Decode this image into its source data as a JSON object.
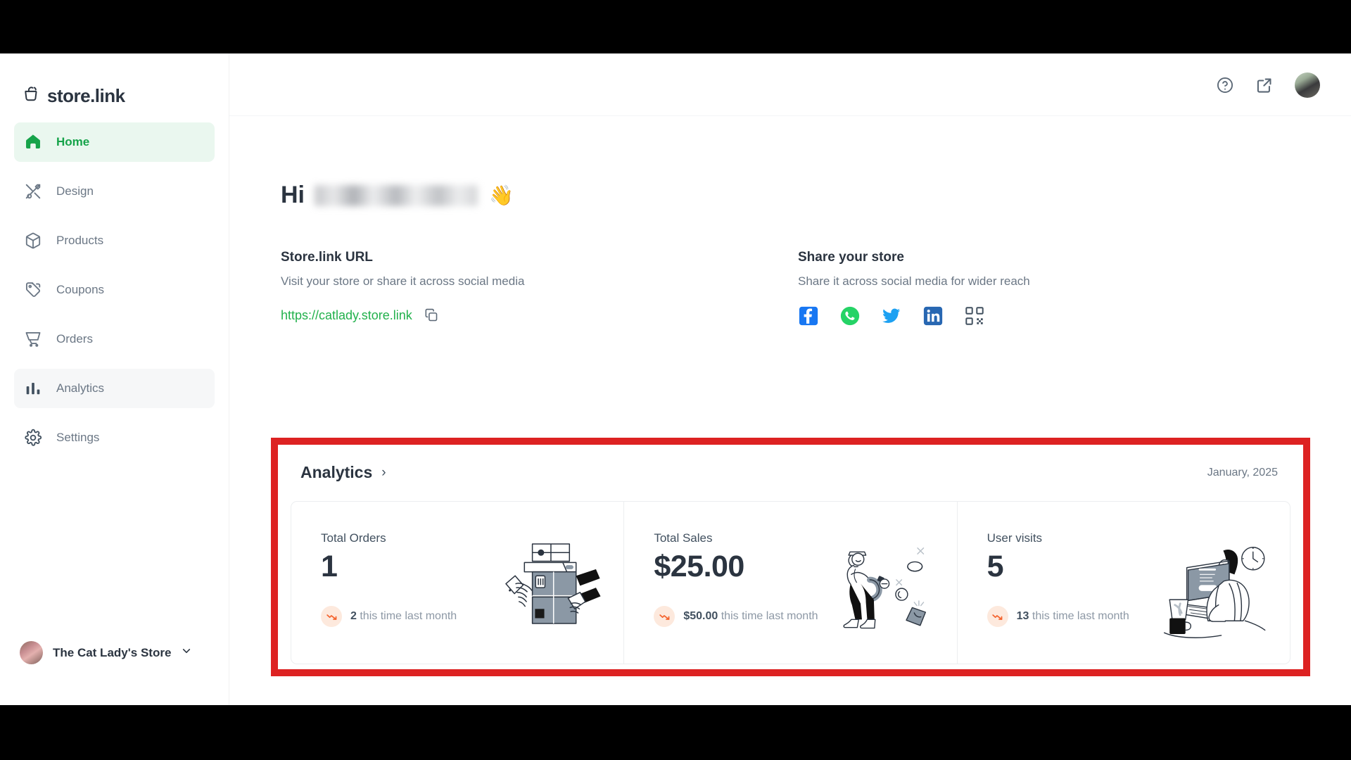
{
  "brand": {
    "name": "store.link",
    "logo_icon": "shopping-bag-icon"
  },
  "sidebar": {
    "items": [
      {
        "label": "Home",
        "icon": "home-icon",
        "state": "active"
      },
      {
        "label": "Design",
        "icon": "design-icon",
        "state": "default"
      },
      {
        "label": "Products",
        "icon": "box-icon",
        "state": "default"
      },
      {
        "label": "Coupons",
        "icon": "tag-icon",
        "state": "default"
      },
      {
        "label": "Orders",
        "icon": "cart-icon",
        "state": "default"
      },
      {
        "label": "Analytics",
        "icon": "bar-chart-icon",
        "state": "hover"
      },
      {
        "label": "Settings",
        "icon": "gear-icon",
        "state": "default"
      }
    ],
    "store_switcher": {
      "name": "The Cat Lady's Store",
      "chevron": "chevron-down-icon",
      "avatar": "store-avatar"
    }
  },
  "topbar": {
    "help_icon": "help-circle-icon",
    "external_link_icon": "external-link-icon",
    "avatar": "user-avatar"
  },
  "greeting": {
    "prefix": "Hi",
    "name_redacted": true,
    "emoji": "👋"
  },
  "store_url": {
    "title": "Store.link URL",
    "subtitle": "Visit your store or share it across social media",
    "url": "https://catlady.store.link",
    "copy_icon": "copy-icon"
  },
  "share": {
    "title": "Share your store",
    "subtitle": "Share it across social media for wider reach",
    "channels": [
      {
        "name": "facebook-icon",
        "color": "#1877F2"
      },
      {
        "name": "whatsapp-icon",
        "color": "#25D366"
      },
      {
        "name": "twitter-icon",
        "color": "#1DA1F2"
      },
      {
        "name": "linkedin-icon",
        "color": "#2867B2"
      },
      {
        "name": "qr-code-icon",
        "color": "#41505F"
      }
    ]
  },
  "analytics": {
    "title": "Analytics",
    "chevron": "›",
    "date": "January, 2025",
    "highlight_color": "#DD2222",
    "stats": [
      {
        "label": "Total Orders",
        "value": "1",
        "compare_value": "2",
        "compare_text": "this time last month",
        "trend": "down",
        "trend_icon": "trend-down-icon",
        "art": "printer-hands-illustration"
      },
      {
        "label": "Total Sales",
        "value": "$25.00",
        "compare_value": "$50.00",
        "compare_text": "this time last month",
        "trend": "down",
        "trend_icon": "trend-down-icon",
        "art": "magnet-money-illustration"
      },
      {
        "label": "User visits",
        "value": "5",
        "compare_value": "13",
        "compare_text": "this time last month",
        "trend": "down",
        "trend_icon": "trend-down-icon",
        "art": "person-laptop-illustration"
      }
    ]
  },
  "colors": {
    "accent_green": "#22B14C",
    "active_bg": "#EAF7EF",
    "text_dark": "#2B3440",
    "text_muted": "#6B7785",
    "trend_down": "#F4622C",
    "trend_badge_bg": "#FDE9DD"
  }
}
